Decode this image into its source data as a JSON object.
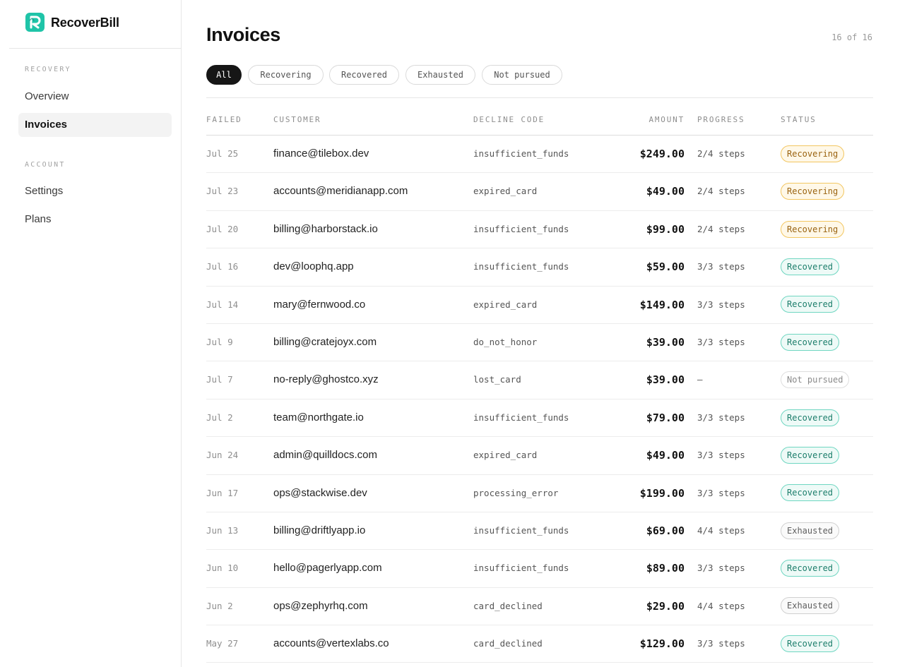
{
  "app": {
    "name": "RecoverBill"
  },
  "sidebar": {
    "sections": [
      {
        "label": "RECOVERY",
        "items": [
          {
            "label": "Overview",
            "active": false
          },
          {
            "label": "Invoices",
            "active": true
          }
        ]
      },
      {
        "label": "ACCOUNT",
        "items": [
          {
            "label": "Settings",
            "active": false
          },
          {
            "label": "Plans",
            "active": false
          }
        ]
      }
    ]
  },
  "main": {
    "title": "Invoices",
    "count": "16 of 16",
    "filters": [
      {
        "label": "All",
        "active": true
      },
      {
        "label": "Recovering",
        "active": false
      },
      {
        "label": "Recovered",
        "active": false
      },
      {
        "label": "Exhausted",
        "active": false
      },
      {
        "label": "Not pursued",
        "active": false
      }
    ],
    "columns": [
      "FAILED",
      "CUSTOMER",
      "DECLINE CODE",
      "AMOUNT",
      "PROGRESS",
      "STATUS"
    ],
    "rows": [
      {
        "failed": "Jul 25",
        "customer": "finance@tilebox.dev",
        "code": "insufficient_funds",
        "amount": "$249.00",
        "progress": "2/4 steps",
        "status": "Recovering",
        "status_kind": "recovering"
      },
      {
        "failed": "Jul 23",
        "customer": "accounts@meridianapp.com",
        "code": "expired_card",
        "amount": "$49.00",
        "progress": "2/4 steps",
        "status": "Recovering",
        "status_kind": "recovering"
      },
      {
        "failed": "Jul 20",
        "customer": "billing@harborstack.io",
        "code": "insufficient_funds",
        "amount": "$99.00",
        "progress": "2/4 steps",
        "status": "Recovering",
        "status_kind": "recovering"
      },
      {
        "failed": "Jul 16",
        "customer": "dev@loophq.app",
        "code": "insufficient_funds",
        "amount": "$59.00",
        "progress": "3/3 steps",
        "status": "Recovered",
        "status_kind": "recovered"
      },
      {
        "failed": "Jul 14",
        "customer": "mary@fernwood.co",
        "code": "expired_card",
        "amount": "$149.00",
        "progress": "3/3 steps",
        "status": "Recovered",
        "status_kind": "recovered"
      },
      {
        "failed": "Jul 9",
        "customer": "billing@cratejoyx.com",
        "code": "do_not_honor",
        "amount": "$39.00",
        "progress": "3/3 steps",
        "status": "Recovered",
        "status_kind": "recovered"
      },
      {
        "failed": "Jul 7",
        "customer": "no-reply@ghostco.xyz",
        "code": "lost_card",
        "amount": "$39.00",
        "progress": "—",
        "status": "Not pursued",
        "status_kind": "not-pursued"
      },
      {
        "failed": "Jul 2",
        "customer": "team@northgate.io",
        "code": "insufficient_funds",
        "amount": "$79.00",
        "progress": "3/3 steps",
        "status": "Recovered",
        "status_kind": "recovered"
      },
      {
        "failed": "Jun 24",
        "customer": "admin@quilldocs.com",
        "code": "expired_card",
        "amount": "$49.00",
        "progress": "3/3 steps",
        "status": "Recovered",
        "status_kind": "recovered"
      },
      {
        "failed": "Jun 17",
        "customer": "ops@stackwise.dev",
        "code": "processing_error",
        "amount": "$199.00",
        "progress": "3/3 steps",
        "status": "Recovered",
        "status_kind": "recovered"
      },
      {
        "failed": "Jun 13",
        "customer": "billing@driftlyapp.io",
        "code": "insufficient_funds",
        "amount": "$69.00",
        "progress": "4/4 steps",
        "status": "Exhausted",
        "status_kind": "exhausted"
      },
      {
        "failed": "Jun 10",
        "customer": "hello@pagerlyapp.com",
        "code": "insufficient_funds",
        "amount": "$89.00",
        "progress": "3/3 steps",
        "status": "Recovered",
        "status_kind": "recovered"
      },
      {
        "failed": "Jun 2",
        "customer": "ops@zephyrhq.com",
        "code": "card_declined",
        "amount": "$29.00",
        "progress": "4/4 steps",
        "status": "Exhausted",
        "status_kind": "exhausted"
      },
      {
        "failed": "May 27",
        "customer": "accounts@vertexlabs.co",
        "code": "card_declined",
        "amount": "$129.00",
        "progress": "3/3 steps",
        "status": "Recovered",
        "status_kind": "recovered"
      }
    ]
  },
  "colors": {
    "brand": "#1fc4a8",
    "brand_dark": "#0e8f7d"
  },
  "icons": {
    "logo": "recoverbill-logo-icon"
  }
}
